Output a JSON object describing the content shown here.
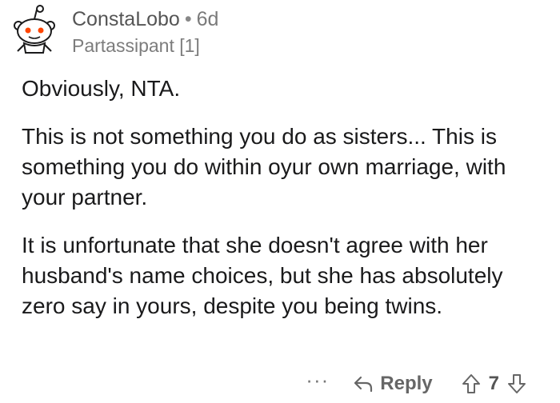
{
  "header": {
    "username": "ConstaLobo",
    "separator": "•",
    "age": "6d",
    "flair": "Partassipant [1]"
  },
  "body": {
    "paragraphs": [
      "Obviously, NTA.",
      "This is not something you do as sisters... This is something you do within oyur own marriage, with your partner.",
      "It is unfortunate that she doesn't agree with her husband's name choices, but she has absolutely zero say in yours, despite you being twins."
    ]
  },
  "actions": {
    "more": "···",
    "reply_label": "Reply",
    "score": "7"
  },
  "colors": {
    "avatar_face": "#ffffff",
    "avatar_eye": "#ff4500",
    "text": "#1a1a1b",
    "meta": "#7c7c7c"
  },
  "icons": {
    "avatar": "reddit-snoo-icon",
    "reply": "reply-arrow-icon",
    "upvote": "upvote-arrow-icon",
    "downvote": "downvote-arrow-icon"
  }
}
